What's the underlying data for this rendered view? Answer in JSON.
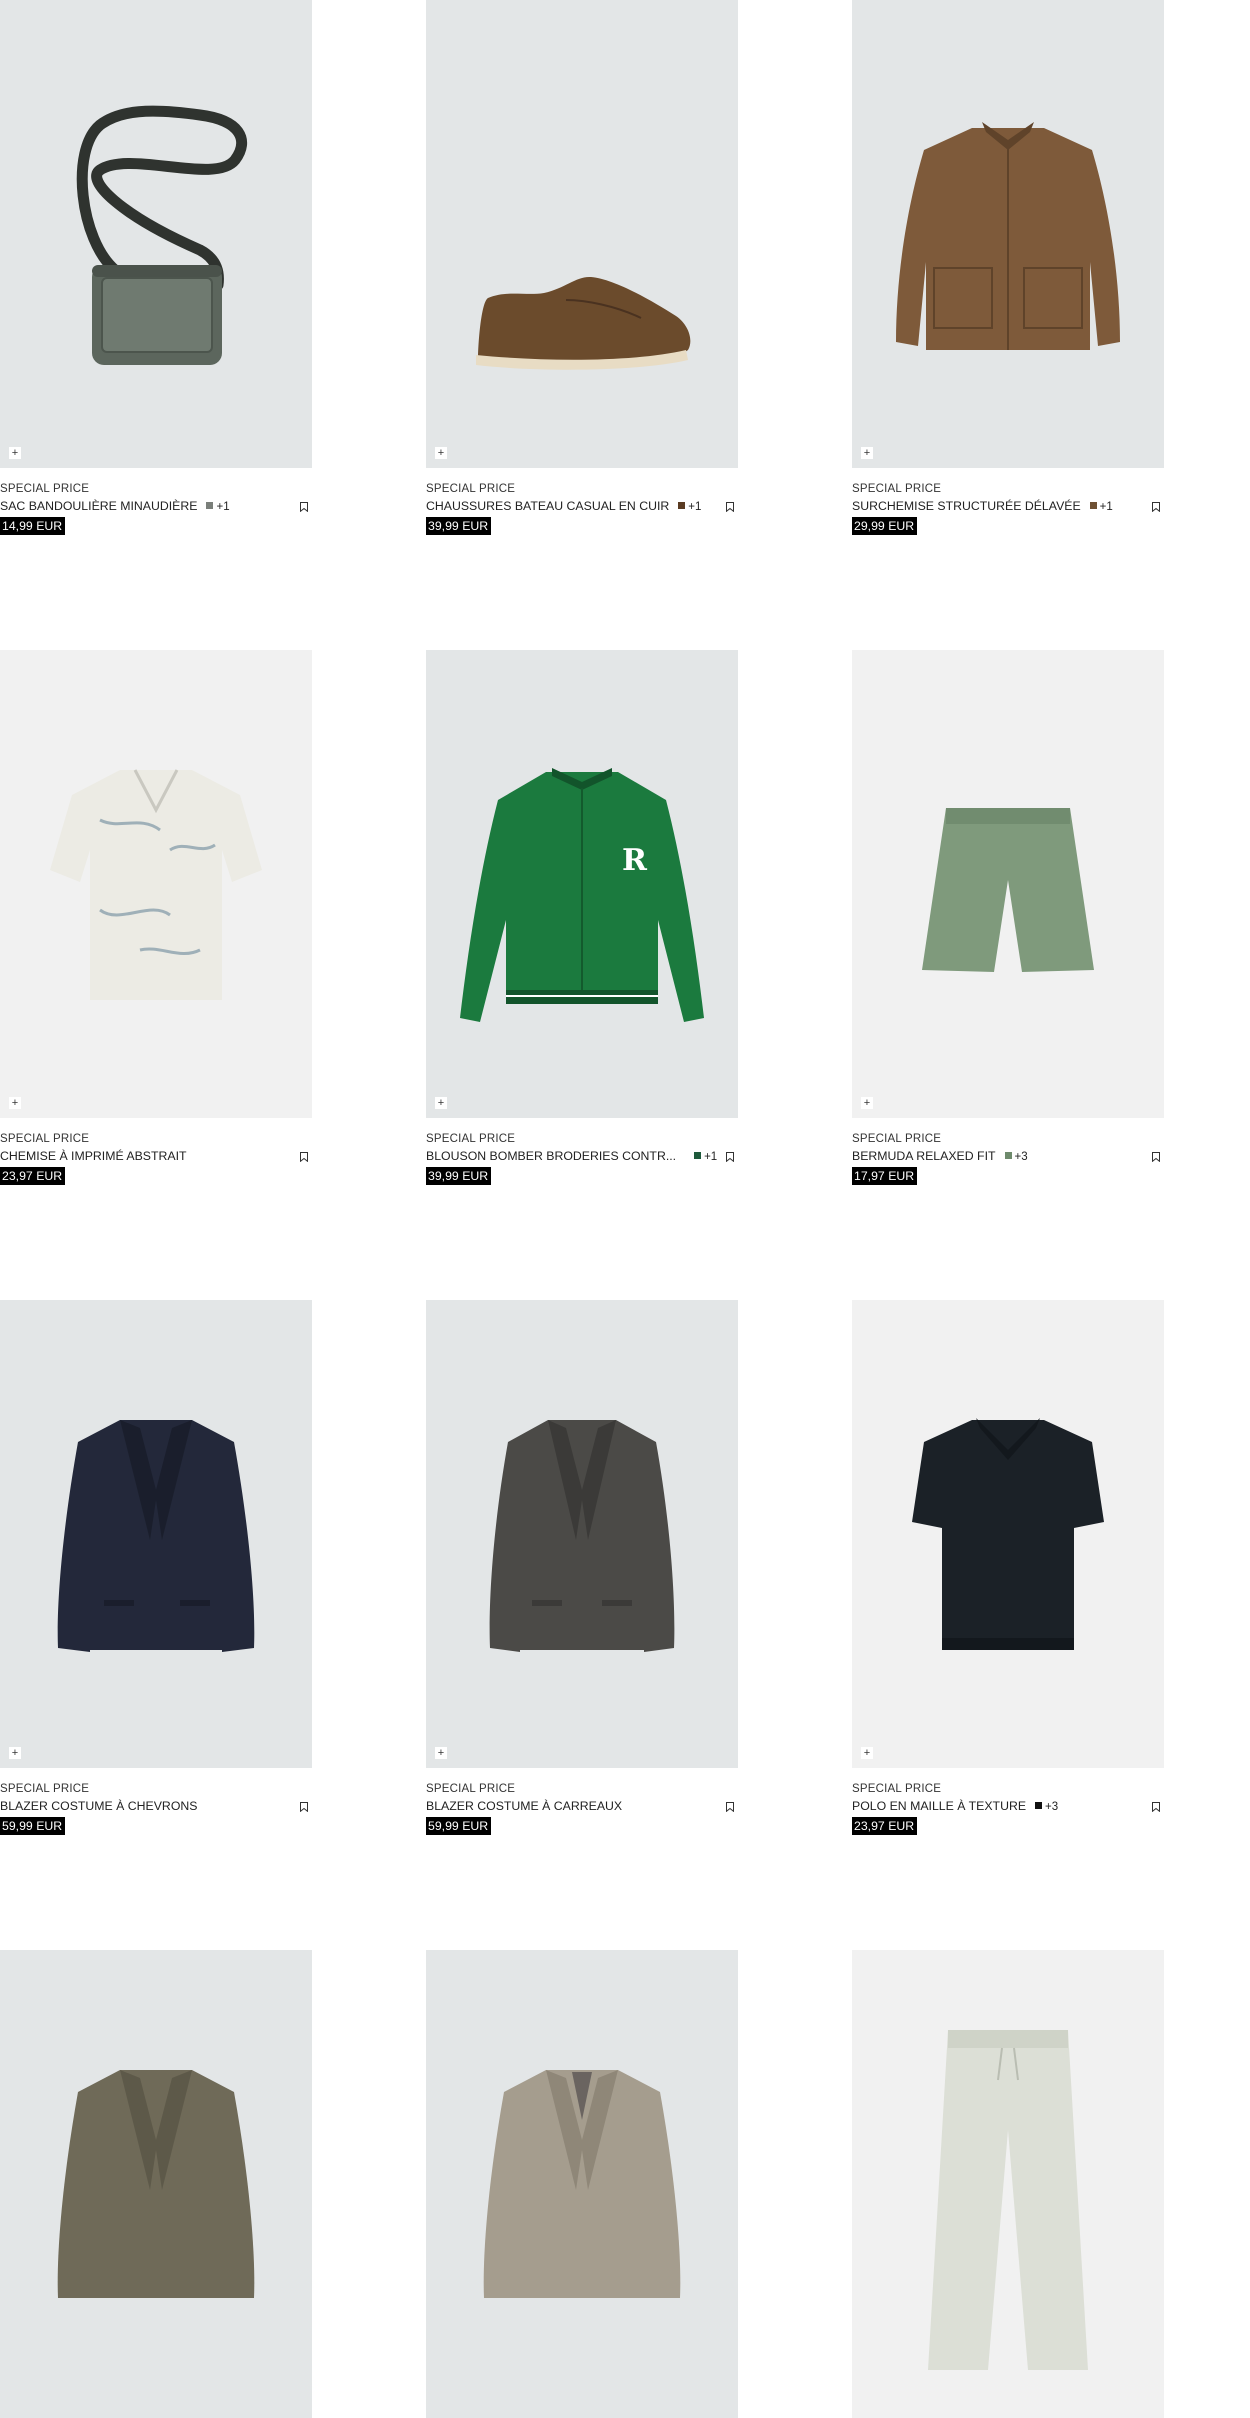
{
  "products": [
    {
      "tag": "SPECIAL PRICE",
      "name": "SAC BANDOULIÈRE MINAUDIÈRE",
      "swatch_color": "#7a7f7a",
      "more": "+1",
      "price": "14,99 EUR",
      "icon": "crossbody-bag"
    },
    {
      "tag": "SPECIAL PRICE",
      "name": "CHAUSSURES BATEAU CASUAL EN CUIR",
      "swatch_color": "#5a3b22",
      "more": "+1",
      "price": "39,99 EUR",
      "icon": "boat-shoe"
    },
    {
      "tag": "SPECIAL PRICE",
      "name": "SURCHEMISE STRUCTURÉE DÉLAVÉE",
      "swatch_color": "#6e5033",
      "more": "+1",
      "price": "29,99 EUR",
      "icon": "overshirt"
    },
    {
      "tag": "SPECIAL PRICE",
      "name": "CHEMISE À IMPRIMÉ ABSTRAIT",
      "swatch_color": "",
      "more": "",
      "price": "23,97 EUR",
      "icon": "printed-shirt"
    },
    {
      "tag": "SPECIAL PRICE",
      "name": "BLOUSON BOMBER BRODERIES CONTR...",
      "swatch_color": "#1e5a3c",
      "more": "+1",
      "price": "39,99 EUR",
      "icon": "bomber-jacket"
    },
    {
      "tag": "SPECIAL PRICE",
      "name": "BERMUDA RELAXED FIT",
      "swatch_color": "#6e8a6c",
      "more": "+3",
      "price": "17,97 EUR",
      "icon": "bermuda-shorts"
    },
    {
      "tag": "SPECIAL PRICE",
      "name": "BLAZER COSTUME À CHEVRONS",
      "swatch_color": "",
      "more": "",
      "price": "59,99 EUR",
      "icon": "navy-blazer"
    },
    {
      "tag": "SPECIAL PRICE",
      "name": "BLAZER COSTUME À CARREAUX",
      "swatch_color": "",
      "more": "",
      "price": "59,99 EUR",
      "icon": "grey-blazer"
    },
    {
      "tag": "SPECIAL PRICE",
      "name": "POLO EN MAILLE À TEXTURE",
      "swatch_color": "#111111",
      "more": "+3",
      "price": "23,97 EUR",
      "icon": "knit-polo"
    },
    {
      "tag": "",
      "name": "",
      "swatch_color": "",
      "more": "",
      "price": "",
      "icon": "olive-blazer"
    },
    {
      "tag": "",
      "name": "",
      "swatch_color": "",
      "more": "",
      "price": "",
      "icon": "beige-blazer"
    },
    {
      "tag": "",
      "name": "",
      "swatch_color": "",
      "more": "",
      "price": "",
      "icon": "jogger-pants"
    }
  ],
  "add_symbol": "+"
}
